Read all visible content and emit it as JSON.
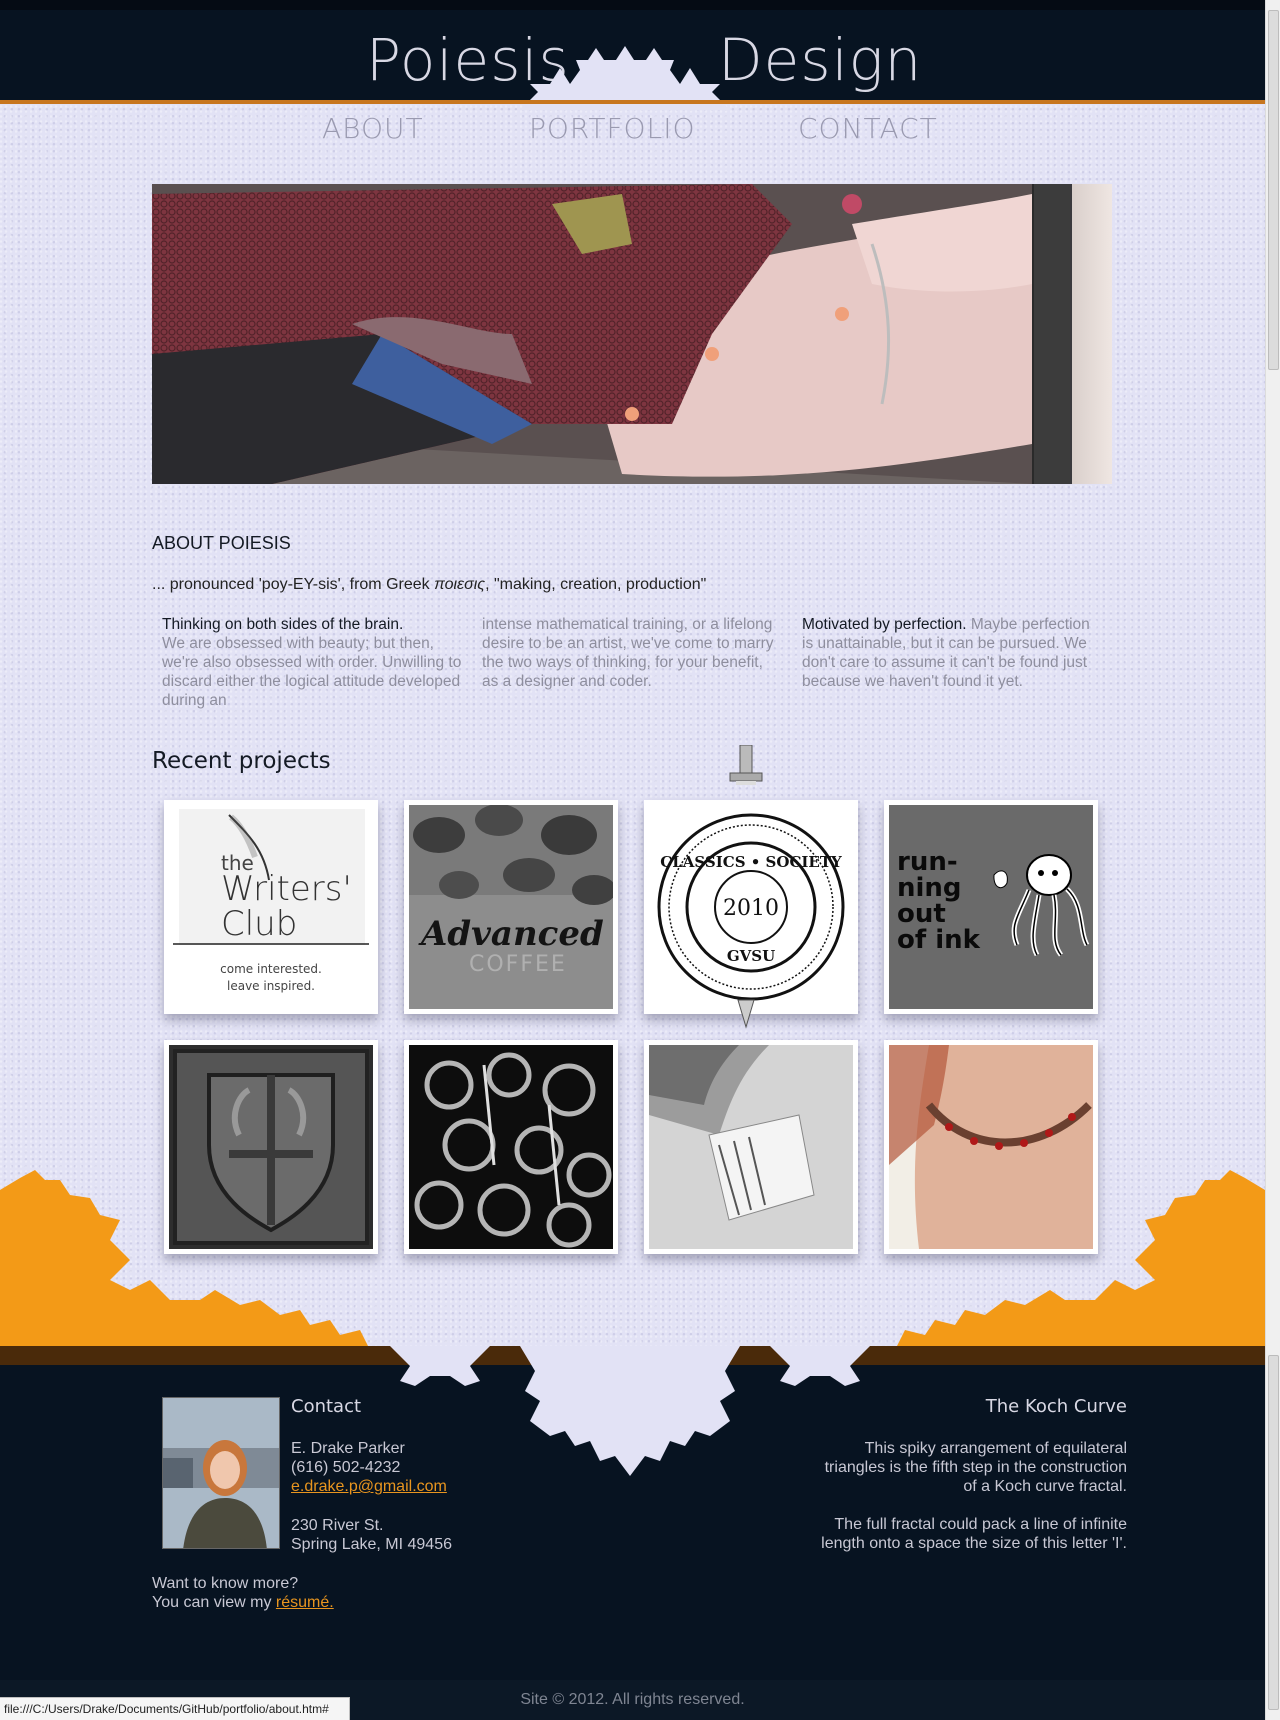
{
  "header": {
    "brand_left": "Poiesis",
    "brand_right": "Design"
  },
  "nav": {
    "items": [
      {
        "label": "ABOUT"
      },
      {
        "label": "PORTFOLIO"
      },
      {
        "label": "CONTACT"
      }
    ]
  },
  "about": {
    "title": "ABOUT POIESIS",
    "pronounce_prefix": "... pronounced 'poy-EY-sis', from Greek ",
    "pronounce_greek": "ποιεσις",
    "pronounce_suffix": ", \"making, creation, production\"",
    "col1_lead": "Thinking on both sides of the brain.",
    "col1_text": "We are obsessed with beauty; but then, we're also obsessed with order. Unwilling to discard either the logical attitude developed during an",
    "col2_text": "intense mathematical training, or a lifelong desire to be an artist, we've come to marry the two ways of thinking, for your benefit, as a designer and coder.",
    "col3_lead": "Motivated by perfection.",
    "col3_text": "Maybe perfection is unattainable, but it can be pursued. We don't care to assume it can't be found just because we haven't found it yet."
  },
  "projects": {
    "title": "Recent projects",
    "writers_club": {
      "the": "the",
      "writers": "Writers'",
      "club": "Club",
      "tag1": "come interested.",
      "tag2": "leave inspired."
    },
    "coffee": {
      "advanced": "Advanced",
      "coffee": "COFFEE"
    },
    "classics": {
      "top": "CLASSICS • SOCIETY",
      "year": "2010",
      "bottom": "GVSU"
    },
    "ink": {
      "line1": "run-",
      "line2": "ning",
      "line3": "out",
      "line4": "of ink"
    }
  },
  "footer": {
    "contact_title": "Contact",
    "name": "E. Drake Parker",
    "phone": "(616) 502-4232",
    "email": "e.drake.p@gmail.com",
    "address1": "230 River St.",
    "address2": "Spring Lake, MI 49456",
    "more1": "Want to know more?",
    "more2": "You can view my ",
    "resume": "résumé.",
    "koch_title": "The Koch Curve",
    "koch_p1": "This spiky arrangement of equilateral triangles is the fifth step in the construction of a Koch curve fractal.",
    "koch_p2": "The full fractal could pack a line of infinite length onto a space the size of this letter 'I'.",
    "copyright": "Site © 2012. All rights reserved."
  },
  "status_bar": {
    "url": "file:///C:/Users/Drake/Documents/GitHub/portfolio/about.htm#"
  },
  "colors": {
    "accent_orange": "#e8951f",
    "navy": "#071321",
    "background": "#e2e2f5"
  },
  "icons": {
    "header_fractal": "koch-snowflake-icon",
    "footer_fractal": "koch-curve-icon"
  }
}
